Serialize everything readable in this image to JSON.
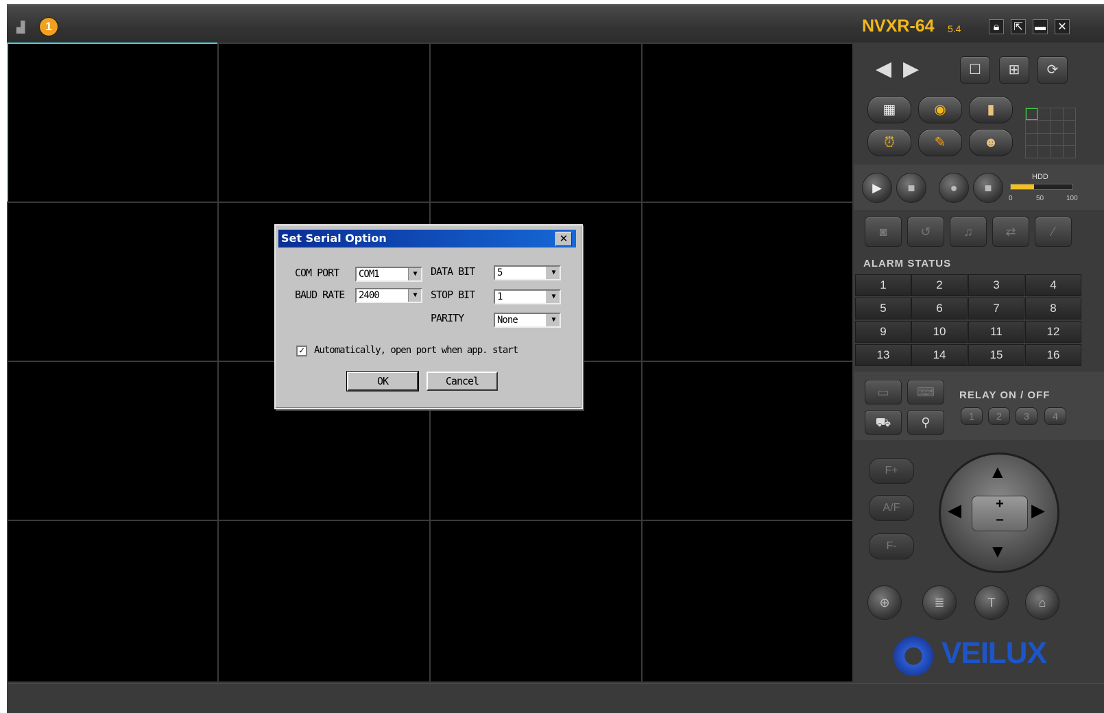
{
  "titlebar": {
    "alert_count": "1",
    "brand": "NVXR-64",
    "version": "5.4"
  },
  "panel": {
    "hdd_label": "HDD",
    "hdd_ticks": [
      "0",
      "50",
      "100"
    ],
    "hdd_usage_percent": 38,
    "alarm_title": "ALARM STATUS",
    "alarm_channels": [
      "1",
      "2",
      "3",
      "4",
      "5",
      "6",
      "7",
      "8",
      "9",
      "10",
      "11",
      "12",
      "13",
      "14",
      "15",
      "16"
    ],
    "relay_title": "RELAY ON / OFF",
    "relays": [
      "1",
      "2",
      "3",
      "4"
    ],
    "focus_buttons": [
      "F+",
      "A/F",
      "F-"
    ],
    "logo": "VEILUX"
  },
  "dialog": {
    "title": "Set Serial Option",
    "com_port_label": "COM PORT",
    "com_port_value": "COM1",
    "baud_rate_label": "BAUD RATE",
    "baud_rate_value": "2400",
    "data_bit_label": "DATA BIT",
    "data_bit_value": "5",
    "stop_bit_label": "STOP BIT",
    "stop_bit_value": "1",
    "parity_label": "PARITY",
    "parity_value": "None",
    "auto_open_label": "Automatically, open port when app. start",
    "auto_open_checked": true,
    "ok_label": "OK",
    "cancel_label": "Cancel"
  },
  "colors": {
    "brand": "#f2b81c",
    "selected_cell": "#4fd0d4",
    "dialog_title": "#0a2e96",
    "logo": "#1d55c8"
  }
}
